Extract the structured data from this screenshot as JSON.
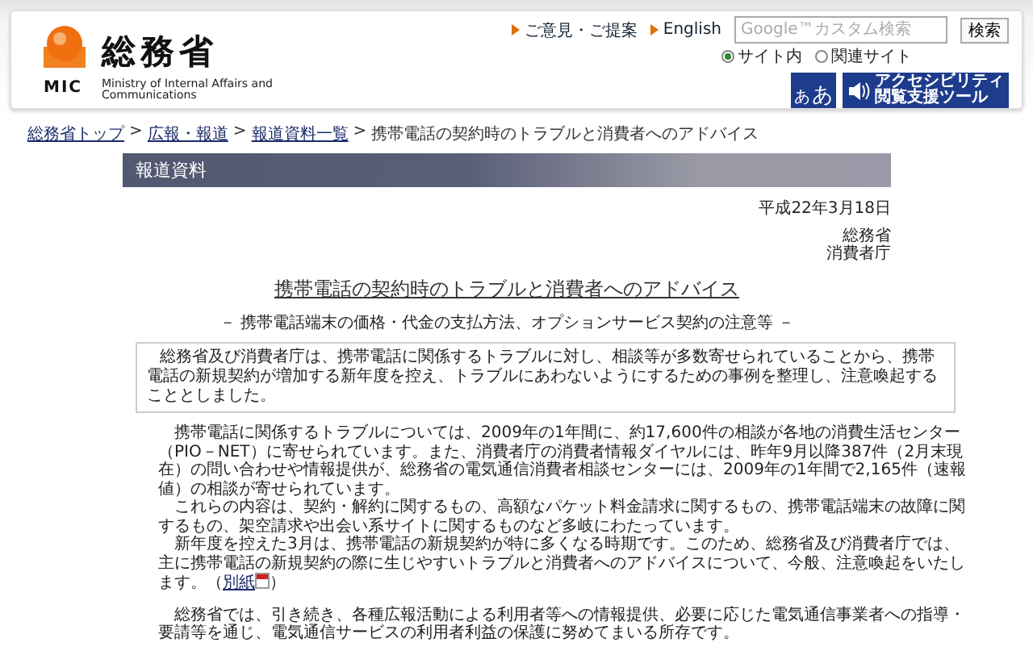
{
  "header": {
    "logo": {
      "kanji": "総務省",
      "abbr": "MIC",
      "english": "Ministry of Internal Affairs and Communications"
    },
    "links": [
      "ご意見・ご提案",
      "English"
    ],
    "search": {
      "placeholder": "Google™カスタム検索",
      "button": "検索",
      "scopes": [
        {
          "label": "サイト内",
          "selected": true
        },
        {
          "label": "関連サイト",
          "selected": false
        }
      ]
    },
    "text_size_button": [
      "あ",
      "あ"
    ],
    "accessibility_tool": [
      "アクセシビリティ",
      "閲覧支援ツール"
    ]
  },
  "breadcrumb": [
    {
      "kind": "link",
      "label": "総務省トップ"
    },
    {
      "kind": "separator",
      "label": ">"
    },
    {
      "kind": "link",
      "label": "広報・報道"
    },
    {
      "kind": "separator",
      "label": ">"
    },
    {
      "kind": "link",
      "label": "報道資料一覧"
    },
    {
      "kind": "separator",
      "label": ">"
    },
    {
      "kind": "current",
      "label": "携帯電話の契約時のトラブルと消費者へのアドバイス"
    }
  ],
  "banner": "報道資料",
  "date": "平成22年3月18日",
  "issuers": [
    "総務省",
    "消費者庁"
  ],
  "title": "携帯電話の契約時のトラブルと消費者へのアドバイス",
  "subtitle": "－ 携帯電話端末の価格・代金の支払方法、オプションサービス契約の注意等 －",
  "summary": "総務省及び消費者庁は、携帯電話に関係するトラブルに対し、相談等が多数寄せられていることから、携帯電話の新規契約が増加する新年度を控え、トラブルにあわないようにするための事例を整理し、注意喚起することとしました。",
  "body_sections": [
    {
      "paragraphs": [
        {
          "text": "携帯電話に関係するトラブルについては、2009年の1年間に、約17,600件の相談が各地の消費生活センター（PIO－NET）に寄せられています。また、消費者庁の消費者情報ダイヤルには、昨年9月以降387件（2月末現在）の問い合わせや情報提供が、総務省の電気通信消費者相談センターには、2009年の1年間で2,165件（速報値）の相談が寄せられています。"
        },
        {
          "text": "これらの内容は、契約・解約に関するもの、高額なパケット料金請求に関するもの、携帯電話端末の故障に関するもの、架空請求や出会い系サイトに関するものなど多岐にわたっています。"
        },
        {
          "text": "新年度を控えた3月は、携帯電話の新規契約が特に多くなる時期です。このため、総務省及び消費者庁では、主に携帯電話の新規契約の際に生じやすいトラブルと消費者へのアドバイスについて、今般、注意喚起をいたします。（",
          "link": "別紙",
          "after": "）"
        }
      ]
    },
    {
      "paragraphs": [
        {
          "text": "総務省では、引き続き、各種広報活動による利用者等への情報提供、必要に応じた電気通信事業者への指導・要請等を通じ、電気通信サービスの利用者利益の保護に努めてまいる所存です。"
        }
      ]
    }
  ]
}
